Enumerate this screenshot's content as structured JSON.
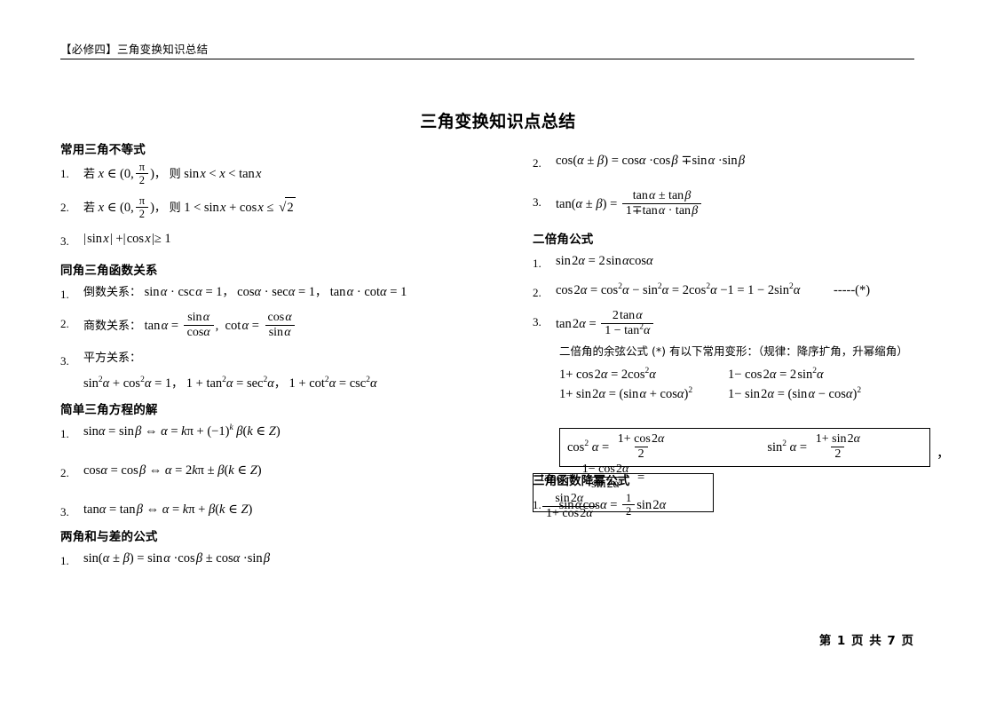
{
  "header": {
    "running_head": "【必修四】三角变换知识总结"
  },
  "title": "三角变换知识点总结",
  "footer": {
    "page_label": "第 1 页  共 7 页"
  },
  "left_column": {
    "sections": [
      {
        "heading": "常用三角不等式",
        "items": [
          {
            "num": "1.",
            "text": "若 x ∈ (0, π/2)，则 sin x < x < tan x"
          },
          {
            "num": "2.",
            "text": "若 x ∈ (0, π/2)，则 1 < sin x + cos x ≤ √2"
          },
          {
            "num": "3.",
            "text": "| sin x | + | cos x | ≥ 1"
          }
        ]
      },
      {
        "heading": "同角三角函数关系",
        "items": [
          {
            "num": "1.",
            "label": "倒数关系：",
            "text": "sinα · cscα = 1，cosα · secα = 1，tanα · cotα = 1"
          },
          {
            "num": "2.",
            "label": "商数关系：",
            "text": "tanα = sinα/cosα，cotα = cosα/sinα"
          },
          {
            "num": "3.",
            "label": "平方关系：",
            "text": "sin²α + cos²α = 1，1 + tan²α = sec²α，1 + cot²α = csc²α"
          }
        ]
      },
      {
        "heading": "简单三角方程的解",
        "items": [
          {
            "num": "1.",
            "text": "sinα = sinβ ⇔ α = kπ + (−1)^k β (k ∈ Z)"
          },
          {
            "num": "2.",
            "text": "cosα = cosβ ⇔ α = 2kπ ± β (k ∈ Z)"
          },
          {
            "num": "3.",
            "text": "tanα = tanβ ⇔ α = kπ + β (k ∈ Z)"
          }
        ]
      },
      {
        "heading": "两角和与差的公式",
        "items": [
          {
            "num": "1.",
            "text": "sin(α ± β) = sinα · cosβ ± cosα · sinβ"
          }
        ]
      }
    ]
  },
  "right_column": {
    "sum_diff_continued": [
      {
        "num": "2.",
        "text": "cos(α ± β) = cosα · cosβ ∓ sinα · sinβ"
      },
      {
        "num": "3.",
        "text": "tan(α ± β) = (tanα ± tanβ) / (1 ∓ tanα · tanβ)"
      }
    ],
    "double_angle": {
      "heading": "二倍角公式",
      "items": [
        {
          "num": "1.",
          "text": "sin 2α = 2 sinα cosα"
        },
        {
          "num": "2.",
          "text": "cos 2α = cos²α − sin²α = 2cos²α − 1 = 1 − 2sin²α",
          "tag": "-----(*)"
        },
        {
          "num": "3.",
          "text": "tan 2α = 2tanα / (1 − tan²α)"
        }
      ],
      "note": "二倍角的余弦公式 (*) 有以下常用变形：（规律：降序扩角，升幂缩角）",
      "variants": [
        {
          "left": "1 + cos 2α = 2cos²α",
          "right": "1 − cos 2α = 2sin²α"
        },
        {
          "left": "1 + sin 2α = (sinα + cosα)²",
          "right": "1 − sin 2α = (sinα − cosα)²"
        }
      ],
      "boxed_1": {
        "formula_a": "cos²α = (1 + cos 2α) / 2",
        "formula_b": "sin²α = (1 + sin 2α) / 2",
        "trailing_comma": "，"
      },
      "boxed_2": {
        "formula": "tanα = (1 − cos 2α) / sin 2α = sin 2α / (1 + cos 2α)"
      }
    },
    "power_reduction": {
      "heading": "三角函数降幂公式",
      "items": [
        {
          "num": "1.",
          "text": "sinα cosα = (1/2) sin 2α"
        }
      ]
    }
  }
}
